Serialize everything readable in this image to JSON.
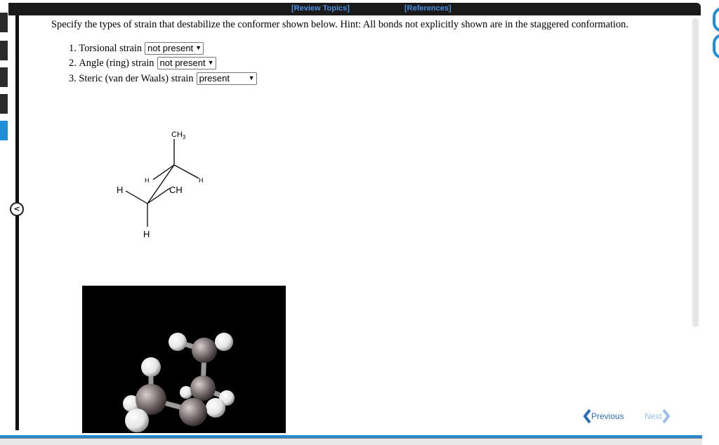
{
  "header": {
    "review_topics": "[Review Topics]",
    "references": "[References]"
  },
  "question": {
    "prompt": "Specify the types of strain that destabilize the conformer shown below. Hint: All bonds not explicitly shown are in the staggered conformation.",
    "items": [
      {
        "number": "1.",
        "label": "Torsional strain",
        "selected": "not present"
      },
      {
        "number": "2.",
        "label": "Angle (ring) strain",
        "selected": "not present"
      },
      {
        "number": "3.",
        "label": "Steric (van der Waals) strain",
        "selected": "present"
      }
    ]
  },
  "structure": {
    "top_label": "CH3",
    "mid_label": "CH3",
    "h_left": "H",
    "h_upper": "H",
    "h_right": "H",
    "h_bottom": "H"
  },
  "nav": {
    "previous": "Previous",
    "next": "Next"
  },
  "collapse_icon": "chevron-left-icon",
  "colors": {
    "accent": "#1e8fd5",
    "link": "#4a90e2",
    "nav_link": "#2a6ebb"
  }
}
